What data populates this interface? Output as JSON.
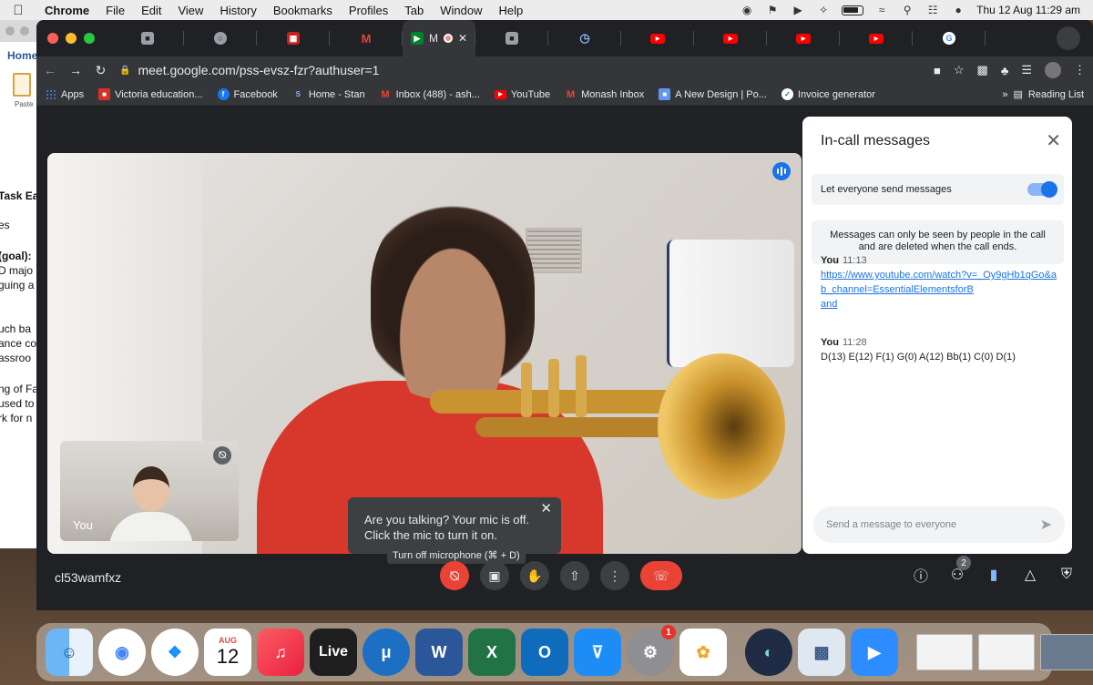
{
  "menubar": {
    "app": "Chrome",
    "menus": [
      "File",
      "Edit",
      "View",
      "History",
      "Bookmarks",
      "Profiles",
      "Tab",
      "Window",
      "Help"
    ],
    "clock": "Thu 12 Aug  11:29 am"
  },
  "background_window": {
    "home_tab": "Home",
    "paste_label": "Paste",
    "fragments": [
      "Task Ear",
      "es",
      "(goal):",
      "D majo",
      "guing a",
      "uch ba",
      "ance co",
      "assroo",
      "ng of Fa",
      "used to",
      "rk for n"
    ]
  },
  "browser": {
    "active_tab_label": "M",
    "url": "meet.google.com/pss-evsz-fzr?authuser=1",
    "bookmarks": [
      {
        "label": "Apps"
      },
      {
        "label": "Victoria education..."
      },
      {
        "label": "Facebook"
      },
      {
        "label": "Home - Stan"
      },
      {
        "label": "Inbox (488) - ash..."
      },
      {
        "label": "YouTube"
      },
      {
        "label": "Monash Inbox"
      },
      {
        "label": "A New Design | Po..."
      },
      {
        "label": "Invoice generator"
      }
    ],
    "bookmarks_overflow": "»",
    "reading_list": "Reading List"
  },
  "meet": {
    "self_name": "You",
    "popup": {
      "line1": "Are you talking? Your mic is off.",
      "line2": "Click the mic to turn it on."
    },
    "tooltip": "Turn off microphone (⌘ + D)",
    "meeting_code": "cl53wamfxz",
    "participants_count": "2",
    "panel": {
      "title": "In-call messages",
      "toggle_label": "Let everyone send messages",
      "info": "Messages can only be seen by people in the call and are deleted when the call ends.",
      "messages": [
        {
          "sender": "You",
          "time": "11:13",
          "link": "https://www.youtube.com/watch?v=_Oy9gHb1qGo&ab_channel=EssentialElementsforB",
          "tail": "and"
        },
        {
          "sender": "You",
          "time": "11:28",
          "text": "D(13) E(12) F(1) G(0) A(12) Bb(1) C(0) D(1)"
        }
      ],
      "input_placeholder": "Send a message to everyone"
    }
  },
  "dock": {
    "calendar_month": "AUG",
    "calendar_day": "12",
    "live_label": "Live",
    "notification_count": "1"
  }
}
